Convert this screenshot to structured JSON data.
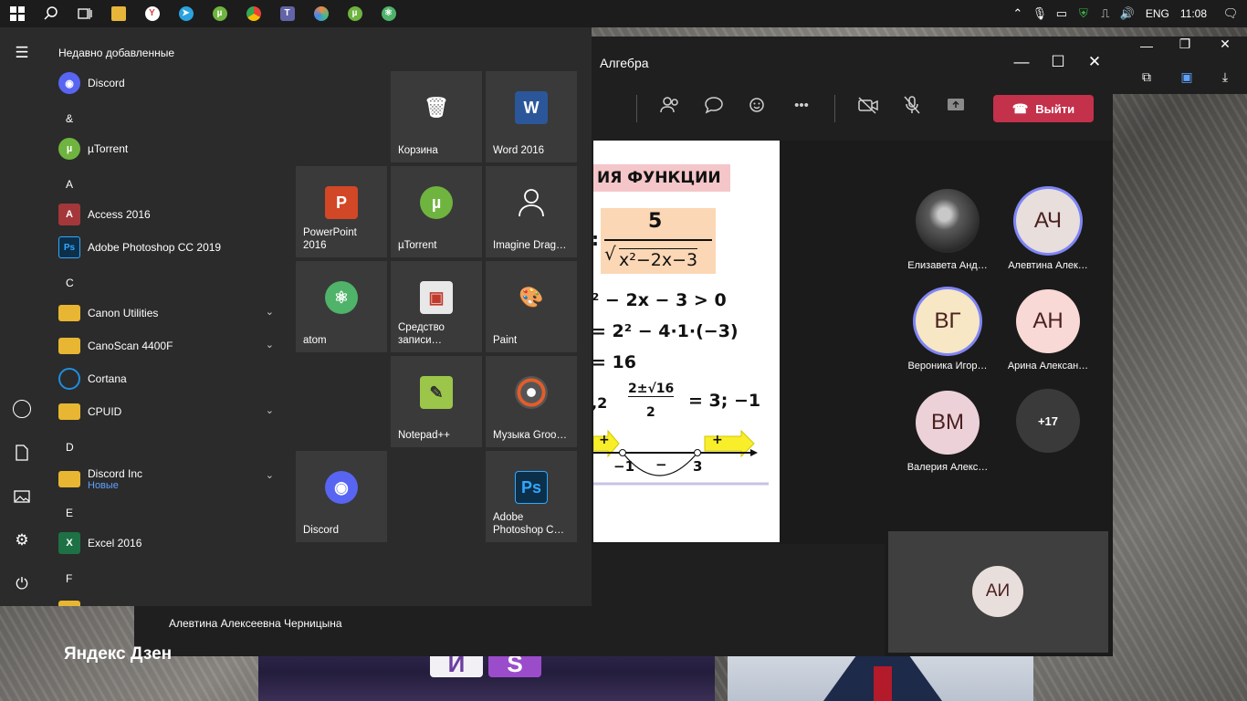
{
  "taskbar": {
    "start_icon": "windows-logo-icon",
    "search_icon": "search-icon",
    "taskview_icon": "task-view-icon",
    "pinned": [
      {
        "name": "file-explorer",
        "color": "#e7b53a",
        "glyph": ""
      },
      {
        "name": "yandex-browser",
        "color": "#e23b3b",
        "glyph": "Y"
      },
      {
        "name": "telegram",
        "color": "#2aa3df",
        "glyph": ""
      },
      {
        "name": "utorrent",
        "color": "#6fb43f",
        "glyph": ""
      },
      {
        "name": "chrome",
        "color": "#e0a100",
        "glyph": ""
      },
      {
        "name": "teams",
        "color": "#6264a7",
        "glyph": "T"
      },
      {
        "name": "color-tool",
        "color": "#44b86b",
        "glyph": ""
      },
      {
        "name": "utorrent-2",
        "color": "#6fb43f",
        "glyph": ""
      },
      {
        "name": "atom",
        "color": "#4fb36a",
        "glyph": ""
      }
    ],
    "tray": {
      "language": "ENG",
      "time": "11:08"
    }
  },
  "start_menu": {
    "recently_added_title": "Недавно добавленные",
    "apps": [
      {
        "type": "app",
        "label": "Discord",
        "icon": "discord-icon",
        "color": "#5865f2",
        "glyph": "◉"
      },
      {
        "type": "letter",
        "label": "&"
      },
      {
        "type": "app",
        "label": "µTorrent",
        "icon": "utorrent-icon",
        "color": "#6fb43f",
        "glyph": "µ"
      },
      {
        "type": "letter",
        "label": "A"
      },
      {
        "type": "app",
        "label": "Access 2016",
        "icon": "access-icon",
        "color": "#a4373a",
        "glyph": "A"
      },
      {
        "type": "app",
        "label": "Adobe Photoshop CC 2019",
        "icon": "photoshop-icon",
        "color": "#0c2f4a",
        "glyph": "Ps"
      },
      {
        "type": "letter",
        "label": "C"
      },
      {
        "type": "folder",
        "label": "Canon Utilities",
        "icon": "folder-icon",
        "color": "#e8b632",
        "glyph": ""
      },
      {
        "type": "folder",
        "label": "CanoScan 4400F",
        "icon": "folder-icon",
        "color": "#e8b632",
        "glyph": ""
      },
      {
        "type": "app",
        "label": "Cortana",
        "icon": "cortana-icon",
        "color": "#1e8fe0",
        "glyph": "○"
      },
      {
        "type": "folder",
        "label": "CPUID",
        "icon": "folder-icon",
        "color": "#e8b632",
        "glyph": ""
      },
      {
        "type": "letter",
        "label": "D"
      },
      {
        "type": "folder",
        "label": "Discord Inc",
        "sub": "Новые",
        "icon": "folder-icon",
        "color": "#e8b632",
        "glyph": ""
      },
      {
        "type": "letter",
        "label": "E"
      },
      {
        "type": "app",
        "label": "Excel 2016",
        "icon": "excel-icon",
        "color": "#1e7145",
        "glyph": "X"
      },
      {
        "type": "letter",
        "label": "F"
      }
    ],
    "tiles": [
      {
        "label": "Корзина",
        "icon": "recycle-bin-icon",
        "color": "#8fb6d9",
        "glyph": "🗑"
      },
      {
        "label": "Word 2016",
        "icon": "word-icon",
        "color": "#2b579a",
        "glyph": "W"
      },
      {
        "label": "PowerPoint 2016",
        "icon": "powerpoint-icon",
        "color": "#d24726",
        "glyph": "P"
      },
      {
        "label": "µTorrent",
        "icon": "utorrent-icon",
        "color": "#6fb43f",
        "glyph": "µ"
      },
      {
        "label": "Imagine Drag…",
        "icon": "person-icon",
        "color": "transparent",
        "glyph": "◯"
      },
      {
        "label": "atom",
        "icon": "atom-icon",
        "color": "#4fb36a",
        "glyph": "⚛"
      },
      {
        "label": "Средство записи…",
        "icon": "steps-recorder-icon",
        "color": "#e8e8e8",
        "glyph": "▣"
      },
      {
        "label": "Paint",
        "icon": "paint-icon",
        "color": "#d9a441",
        "glyph": "🎨"
      },
      {
        "label": "Notepad++",
        "icon": "notepadpp-icon",
        "color": "#9cc64a",
        "glyph": "✎"
      },
      {
        "label": "Музыка Groo…",
        "icon": "groove-music-icon",
        "color": "#555",
        "glyph": "◎"
      },
      {
        "label": "Discord",
        "icon": "discord-icon",
        "color": "#5865f2",
        "glyph": "◉"
      },
      {
        "label": "Adobe Photoshop C…",
        "icon": "photoshop-icon",
        "color": "#0c2f4a",
        "glyph": "Ps"
      }
    ]
  },
  "teams": {
    "title": "Алгебра",
    "leave_label": "Выйти",
    "presenter_name": "Алевтина Алексеевна Черницына",
    "participants": [
      {
        "name": "Елизавета Анд…",
        "initials": "",
        "color": "#555",
        "ring": false,
        "photo": true
      },
      {
        "name": "Алевтина Алек…",
        "initials": "АЧ",
        "color": "#e8dedb",
        "ring": true
      },
      {
        "name": "Вероника Игор…",
        "initials": "ВГ",
        "color": "#f7e7c4",
        "ring": true
      },
      {
        "name": "Арина Алексан…",
        "initials": "АН",
        "color": "#f8d9d5",
        "ring": false
      },
      {
        "name": "Валерия Алекс…",
        "initials": "ВМ",
        "color": "#ecd2d8",
        "ring": false
      }
    ],
    "more_count": "+17",
    "self_initials": "АИ",
    "slide": {
      "heading": "ИЯ ФУНКЦИИ",
      "numerator": "5",
      "denominator": "x²−2x−3",
      "line1": "² − 2x − 3 > 0",
      "line2": "= 2² − 4·1·(−3)",
      "line3": "= 16",
      "line4_prefix": ",2",
      "line4_frac_top": "2±√16",
      "line4_frac_bottom": "2",
      "line4_suffix": "= 3; −1",
      "plus": "+",
      "minus": "−",
      "root1": "−1",
      "root2": "3"
    }
  },
  "desktop": {
    "yandex_text": "Яндекс Дзен",
    "panel_letters": [
      "И",
      "S"
    ]
  }
}
